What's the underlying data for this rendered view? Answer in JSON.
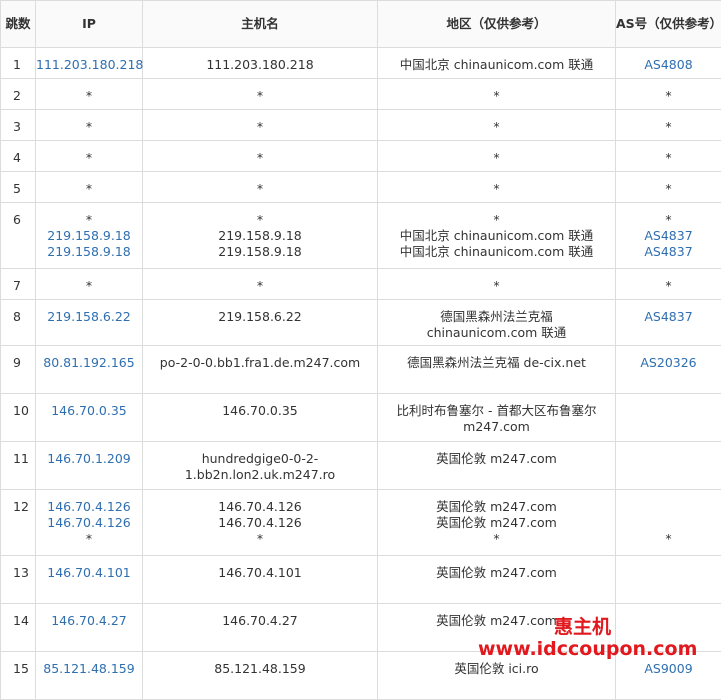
{
  "headers": {
    "hop": "跳数",
    "ip": "IP",
    "host": "主机名",
    "region": "地区（仅供参考）",
    "as": "AS号（仅供参考）"
  },
  "rows": [
    {
      "hop": "1",
      "ip": [
        "111.203.180.218"
      ],
      "host": [
        "111.203.180.218"
      ],
      "region": [
        "中国北京 chinaunicom.com 联通"
      ],
      "as": [
        "AS4808"
      ]
    },
    {
      "hop": "2",
      "ip": [
        "*"
      ],
      "host": [
        "*"
      ],
      "region": [
        "*"
      ],
      "as": [
        "*"
      ]
    },
    {
      "hop": "3",
      "ip": [
        "*"
      ],
      "host": [
        "*"
      ],
      "region": [
        "*"
      ],
      "as": [
        "*"
      ]
    },
    {
      "hop": "4",
      "ip": [
        "*"
      ],
      "host": [
        "*"
      ],
      "region": [
        "*"
      ],
      "as": [
        "*"
      ]
    },
    {
      "hop": "5",
      "ip": [
        "*"
      ],
      "host": [
        "*"
      ],
      "region": [
        "*"
      ],
      "as": [
        "*"
      ]
    },
    {
      "hop": "6",
      "ip": [
        "*",
        "219.158.9.18",
        "219.158.9.18"
      ],
      "host": [
        "*",
        "219.158.9.18",
        "219.158.9.18"
      ],
      "region": [
        "*",
        "中国北京 chinaunicom.com 联通",
        "中国北京 chinaunicom.com 联通"
      ],
      "as": [
        "*",
        "AS4837",
        "AS4837"
      ]
    },
    {
      "hop": "7",
      "ip": [
        "*"
      ],
      "host": [
        "*"
      ],
      "region": [
        "*"
      ],
      "as": [
        "*"
      ]
    },
    {
      "hop": "8",
      "ip": [
        "219.158.6.22"
      ],
      "host": [
        "219.158.6.22"
      ],
      "region": [
        "德国黑森州法兰克福 chinaunicom.com 联通"
      ],
      "as": [
        "AS4837"
      ]
    },
    {
      "hop": "9",
      "ip": [
        "80.81.192.165"
      ],
      "host": [
        "po-2-0-0.bb1.fra1.de.m247.com"
      ],
      "region": [
        "德国黑森州法兰克福 de-cix.net"
      ],
      "as": [
        "AS20326"
      ]
    },
    {
      "hop": "10",
      "ip": [
        "146.70.0.35"
      ],
      "host": [
        "146.70.0.35"
      ],
      "region": [
        "比利时布鲁塞尔 - 首都大区布鲁塞尔 m247.com"
      ],
      "as": []
    },
    {
      "hop": "11",
      "ip": [
        "146.70.1.209"
      ],
      "host": [
        "hundredgige0-0-2-1.bb2n.lon2.uk.m247.ro"
      ],
      "region": [
        "英国伦敦 m247.com"
      ],
      "as": []
    },
    {
      "hop": "12",
      "ip": [
        "146.70.4.126",
        "146.70.4.126",
        "*"
      ],
      "host": [
        "146.70.4.126",
        "146.70.4.126",
        "*"
      ],
      "region": [
        "英国伦敦 m247.com",
        "英国伦敦 m247.com",
        "*"
      ],
      "as": [
        "",
        "",
        "*"
      ]
    },
    {
      "hop": "13",
      "ip": [
        "146.70.4.101"
      ],
      "host": [
        "146.70.4.101"
      ],
      "region": [
        "英国伦敦 m247.com"
      ],
      "as": []
    },
    {
      "hop": "14",
      "ip": [
        "146.70.4.27"
      ],
      "host": [
        "146.70.4.27"
      ],
      "region": [
        "英国伦敦 m247.com"
      ],
      "as": []
    },
    {
      "hop": "15",
      "ip": [
        "85.121.48.159"
      ],
      "host": [
        "85.121.48.159"
      ],
      "region": [
        "英国伦敦 ici.ro"
      ],
      "as": [
        "AS9009"
      ]
    }
  ],
  "watermark": {
    "line1": "惠主机",
    "line2": "www.idccoupon.com"
  }
}
